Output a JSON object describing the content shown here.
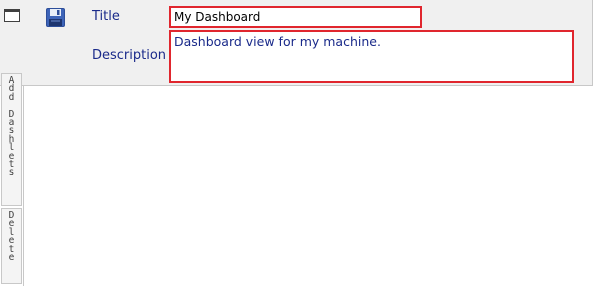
{
  "form": {
    "title_label": "Title",
    "title_value": "My Dashboard",
    "description_label": "Description",
    "description_value": "Dashboard view for my machine."
  },
  "sidebar": {
    "add_dashlets_label": "Add Dashlets",
    "delete_label": "Delete"
  },
  "colors": {
    "highlight_border": "#e0262e",
    "label_text": "#1a2a8a"
  }
}
